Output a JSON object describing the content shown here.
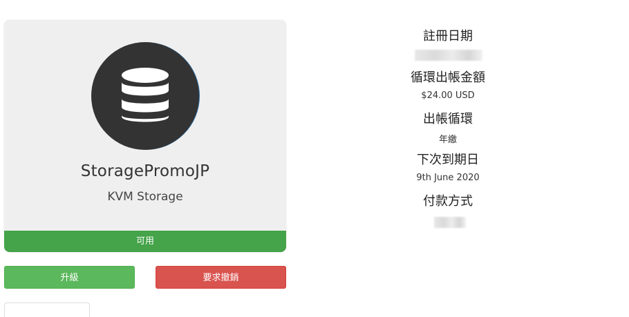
{
  "product": {
    "name": "StoragePromoJP",
    "group": "KVM Storage",
    "status": "可用",
    "icon": "database-icon"
  },
  "actions": {
    "upgrade_label": "升級",
    "cancel_label": "要求撤銷"
  },
  "details": {
    "reg_date_label": "註冊日期",
    "recurring_label": "循環出帳金額",
    "recurring_value": "$24.00 USD",
    "cycle_label": "出帳循環",
    "cycle_value": "年繳",
    "due_label": "下次到期日",
    "due_value": "9th June 2020",
    "payment_label": "付款方式"
  },
  "colors": {
    "status_green": "#45a349",
    "upgrade_green": "#5cb85c",
    "cancel_red": "#d9534f",
    "icon_dark": "#333333"
  }
}
